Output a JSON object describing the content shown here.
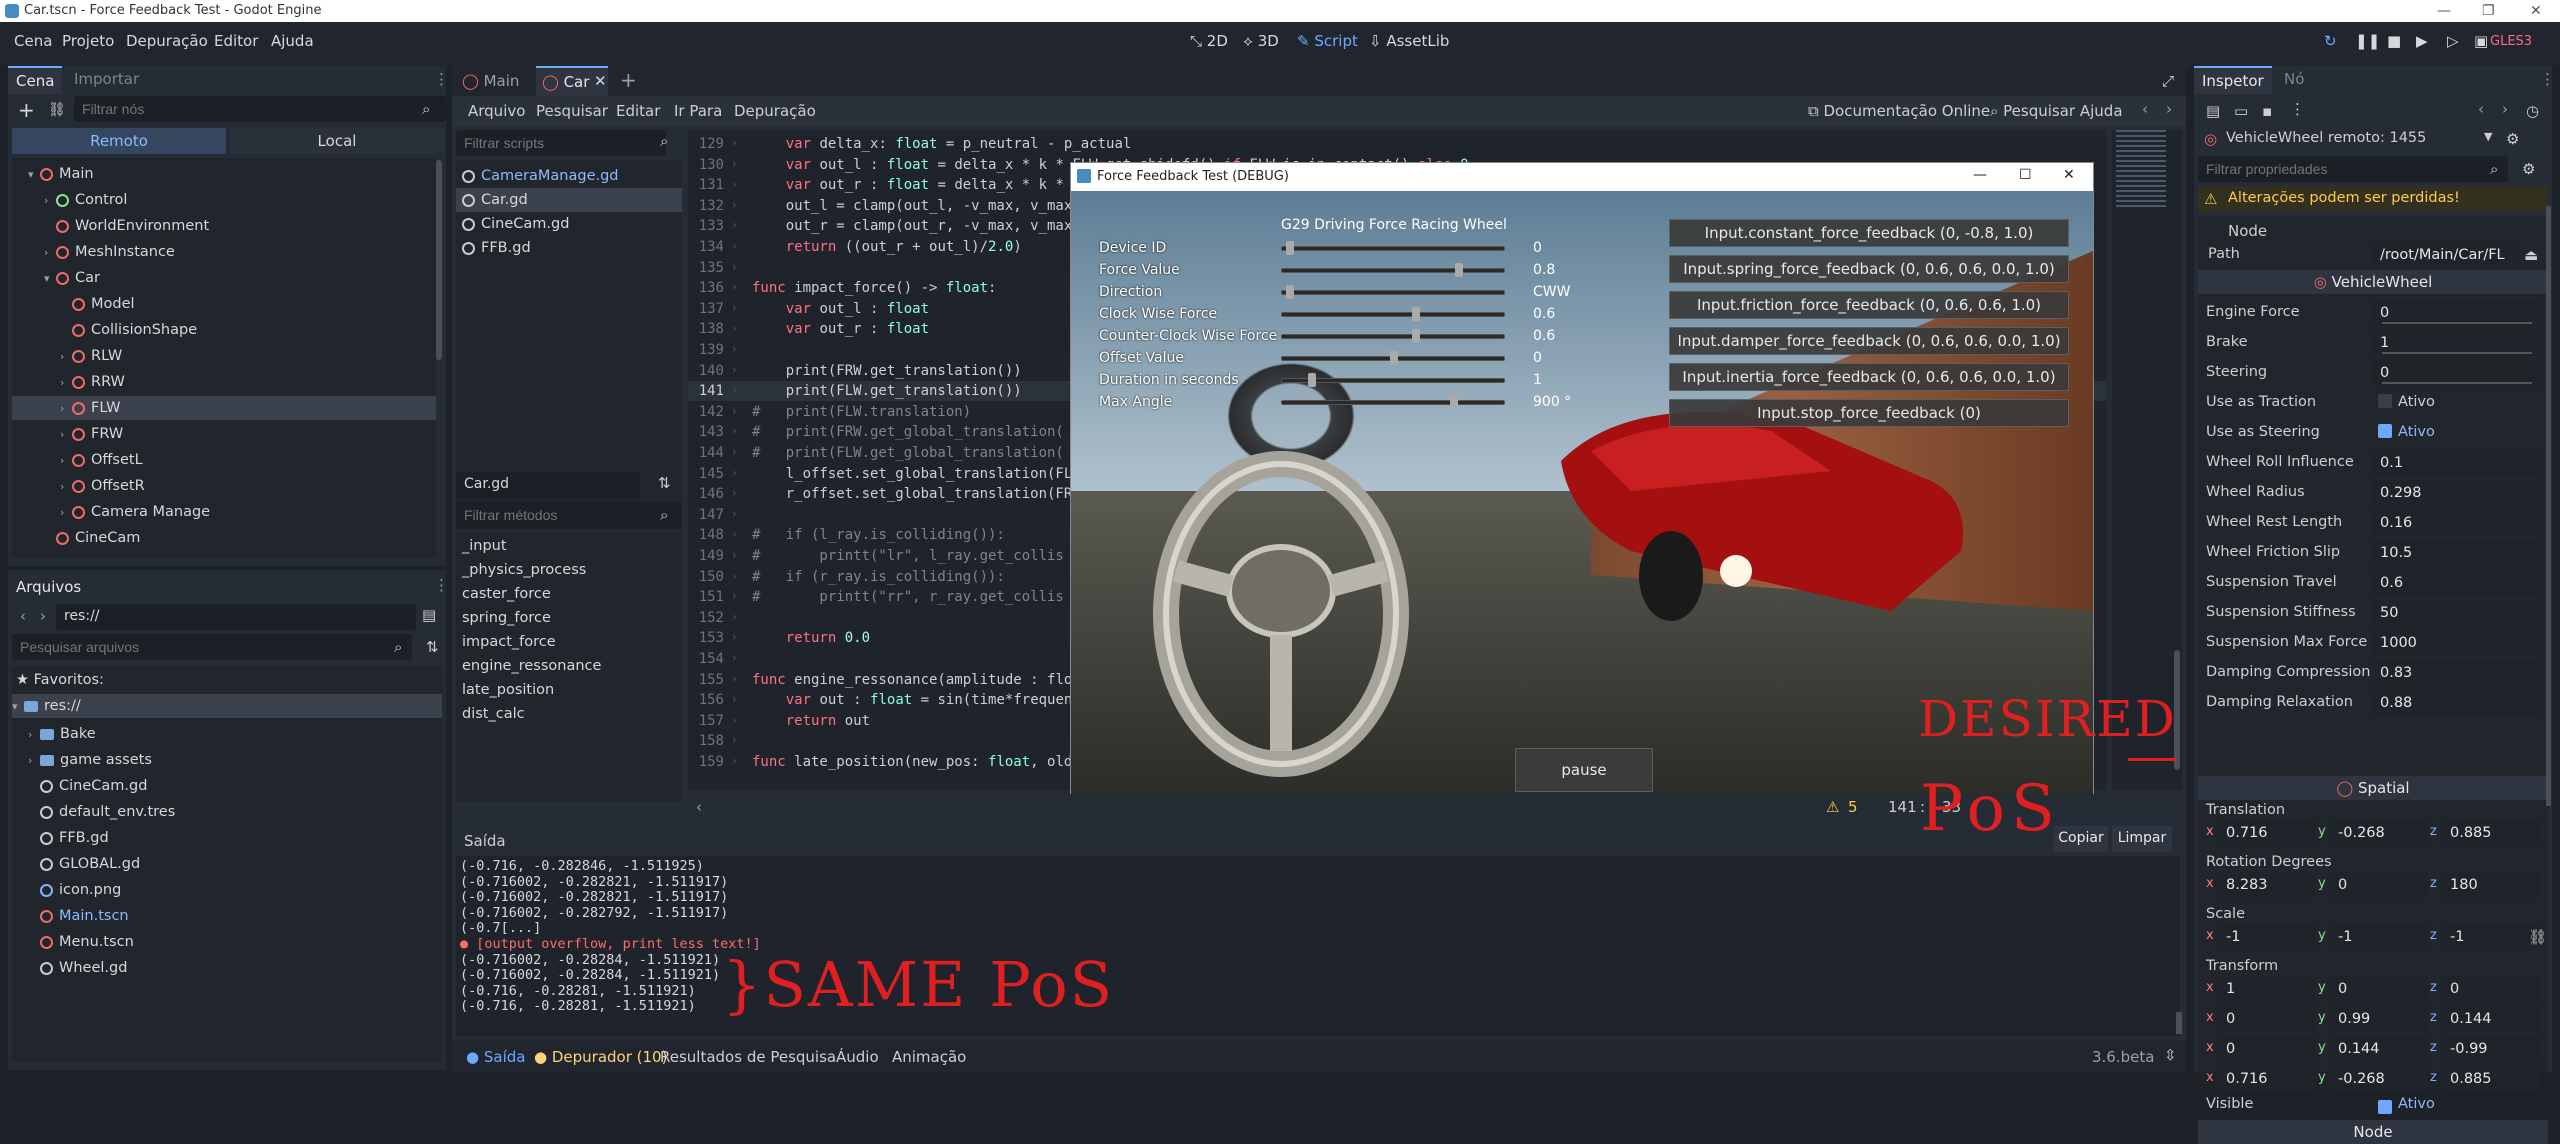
{
  "window": {
    "title": "Car.tscn - Force Feedback Test - Godot Engine"
  },
  "menu": {
    "items": [
      "Cena",
      "Projeto",
      "Depuração",
      "Editor",
      "Ajuda"
    ]
  },
  "main_tabs": [
    "2D",
    "3D",
    "Script",
    "AssetLib"
  ],
  "renderer": "GLES3",
  "scene_dock": {
    "tabs": [
      "Cena",
      "Importar"
    ],
    "filter_placeholder": "Filtrar nós",
    "modes": [
      "Remoto",
      "Local"
    ],
    "tree": [
      {
        "label": "Main",
        "indent": 1,
        "arrow": "▾",
        "icon": "red"
      },
      {
        "label": "Control",
        "indent": 2,
        "arrow": "›",
        "icon": "green"
      },
      {
        "label": "WorldEnvironment",
        "indent": 2,
        "arrow": "",
        "icon": "red"
      },
      {
        "label": "MeshInstance",
        "indent": 2,
        "arrow": "›",
        "icon": "red"
      },
      {
        "label": "Car",
        "indent": 2,
        "arrow": "▾",
        "icon": "red"
      },
      {
        "label": "Model",
        "indent": 3,
        "arrow": "",
        "icon": "red"
      },
      {
        "label": "CollisionShape",
        "indent": 3,
        "arrow": "",
        "icon": "red"
      },
      {
        "label": "RLW",
        "indent": 3,
        "arrow": "›",
        "icon": "red"
      },
      {
        "label": "RRW",
        "indent": 3,
        "arrow": "›",
        "icon": "red"
      },
      {
        "label": "FLW",
        "indent": 3,
        "arrow": "›",
        "icon": "red"
      },
      {
        "label": "FRW",
        "indent": 3,
        "arrow": "›",
        "icon": "red"
      },
      {
        "label": "OffsetL",
        "indent": 3,
        "arrow": "›",
        "icon": "red"
      },
      {
        "label": "OffsetR",
        "indent": 3,
        "arrow": "›",
        "icon": "red"
      },
      {
        "label": "Camera Manage",
        "indent": 3,
        "arrow": "›",
        "icon": "red"
      },
      {
        "label": "CineCam",
        "indent": 2,
        "arrow": "",
        "icon": "red"
      }
    ]
  },
  "files_dock": {
    "title": "Arquivos",
    "path": "res://",
    "search_placeholder": "Pesquisar arquivos",
    "favorites": "Favoritos:",
    "root": "res://",
    "items": [
      {
        "label": "Bake",
        "type": "folder"
      },
      {
        "label": "game assets",
        "type": "folder"
      },
      {
        "label": "CineCam.gd",
        "type": "script"
      },
      {
        "label": "default_env.tres",
        "type": "res"
      },
      {
        "label": "FFB.gd",
        "type": "script"
      },
      {
        "label": "GLOBAL.gd",
        "type": "script"
      },
      {
        "label": "icon.png",
        "type": "image"
      },
      {
        "label": "Main.tscn",
        "type": "scene"
      },
      {
        "label": "Menu.tscn",
        "type": "scene"
      },
      {
        "label": "Wheel.gd",
        "type": "script"
      }
    ]
  },
  "editor_tabs": [
    "Main",
    "Car"
  ],
  "script_menu": [
    "Arquivo",
    "Pesquisar",
    "Editar",
    "Ir Para",
    "Depuração"
  ],
  "script_links": [
    "Documentação Online",
    "Pesquisar Ajuda"
  ],
  "script_filter": "Filtrar scripts",
  "scripts": [
    "CameraManage.gd",
    "Car.gd",
    "CineCam.gd",
    "FFB.gd"
  ],
  "current_script": "Car.gd",
  "method_filter": "Filtrar métodos",
  "methods": [
    "_input",
    "_physics_process",
    "caster_force",
    "spring_force",
    "impact_force",
    "engine_ressonance",
    "late_position",
    "dist_calc"
  ],
  "code_lines": [
    {
      "n": "129",
      "html": "    var delta_x: float = p_neutral - p_actual"
    },
    {
      "n": "130",
      "html": "    var out_l : float = delta_x * k * FLW.get_shidefd() if FLW.is_in_contact() else 0"
    },
    {
      "n": "131",
      "html": "    var out_r : float = delta_x * k * "
    },
    {
      "n": "132",
      "html": "    out_l = clamp(out_l, -v_max, v_max"
    },
    {
      "n": "133",
      "html": "    out_r = clamp(out_r, -v_max, v_max"
    },
    {
      "n": "134",
      "html": "    return ((out_r + out_l)/2.0)"
    },
    {
      "n": "135",
      "html": ""
    },
    {
      "n": "136",
      "html": "func impact_force() -> float:"
    },
    {
      "n": "137",
      "html": "    var out_l : float"
    },
    {
      "n": "138",
      "html": "    var out_r : float"
    },
    {
      "n": "139",
      "html": ""
    },
    {
      "n": "140",
      "html": "    print(FRW.get_translation())"
    },
    {
      "n": "141",
      "html": "    print(FLW.get_translation())"
    },
    {
      "n": "142",
      "html": "#   print(FLW.translation)"
    },
    {
      "n": "143",
      "html": "#   print(FRW.get_global_translation("
    },
    {
      "n": "144",
      "html": "#   print(FLW.get_global_translation("
    },
    {
      "n": "145",
      "html": "    l_offset.set_global_translation(FL"
    },
    {
      "n": "146",
      "html": "    r_offset.set_global_translation(FR"
    },
    {
      "n": "147",
      "html": ""
    },
    {
      "n": "148",
      "html": "#   if (l_ray.is_colliding()):"
    },
    {
      "n": "149",
      "html": "#       printt(\"lr\", l_ray.get_collis"
    },
    {
      "n": "150",
      "html": "#   if (r_ray.is_colliding()):"
    },
    {
      "n": "151",
      "html": "#       printt(\"rr\", r_ray.get_collis"
    },
    {
      "n": "152",
      "html": ""
    },
    {
      "n": "153",
      "html": "    return 0.0"
    },
    {
      "n": "154",
      "html": ""
    },
    {
      "n": "155",
      "html": "func engine_ressonance(amplitude : flo"
    },
    {
      "n": "156",
      "html": "    var out : float = sin(time*frequen"
    },
    {
      "n": "157",
      "html": "    return out"
    },
    {
      "n": "158",
      "html": ""
    },
    {
      "n": "159",
      "html": "func late_position(new_pos: float, old"
    }
  ],
  "status": {
    "warnings": "5",
    "line": "141",
    "col": "33"
  },
  "output": {
    "title": "Saída",
    "copy": "Copiar",
    "clear": "Limpar",
    "lines": [
      "(-0.716, -0.282846, -1.511925)",
      "(-0.716002, -0.282821, -1.511917)",
      "(-0.716002, -0.282821, -1.511917)",
      "(-0.716002, -0.282792, -1.511917)",
      "(-0.7[...]"
    ],
    "error": "[output overflow, print less text!]",
    "lines2": [
      "(-0.716002, -0.28284, -1.511921)",
      "(-0.716002, -0.28284, -1.511921)",
      "(-0.716, -0.28281, -1.511921)",
      "(-0.716, -0.28281, -1.511921)"
    ]
  },
  "bottom_tabs": [
    "Saída",
    "Depurador (10)",
    "Resultados de Pesquisa",
    "Áudio",
    "Animação"
  ],
  "version": "3.6.beta",
  "game_window": {
    "title": "Force Feedback Test (DEBUG)",
    "wheel": "G29 Driving Force Racing Wheel",
    "params": [
      {
        "label": "Device ID",
        "value": "0",
        "pos": 0.02
      },
      {
        "label": "Force Value",
        "value": "0.8",
        "pos": 0.8
      },
      {
        "label": "Direction",
        "value": "CWW",
        "pos": 0.02
      },
      {
        "label": "Clock Wise Force",
        "value": "0.6",
        "pos": 0.6
      },
      {
        "label": "Counter-Clock Wise Force",
        "value": "0.6",
        "pos": 0.6
      },
      {
        "label": "Offset Value",
        "value": "0",
        "pos": 0.5
      },
      {
        "label": "Duration in seconds",
        "value": "1",
        "pos": 0.12
      },
      {
        "label": "Max Angle",
        "value": "900 °",
        "pos": 0.78
      }
    ],
    "buttons": [
      "Input.constant_force_feedback (0, -0.8, 1.0)",
      "Input.spring_force_feedback (0, 0.6, 0.6, 0.0, 1.0)",
      "Input.friction_force_feedback (0, 0.6, 0.6, 1.0)",
      "Input.damper_force_feedback (0, 0.6, 0.6, 0.0, 1.0)",
      "Input.inertia_force_feedback (0, 0.6, 0.6, 0.0, 1.0)",
      "Input.stop_force_feedback (0)"
    ],
    "pause": "pause"
  },
  "inspector": {
    "tabs": [
      "Inspetor",
      "Nó"
    ],
    "object": "VehicleWheel remoto: 1455",
    "filter_placeholder": "Filtrar propriedades",
    "warning": "Alterações podem ser perdidas!",
    "node_section": "Node",
    "path_label": "Path",
    "path_value": "/root/Main/Car/FL",
    "class": "VehicleWheel",
    "props": [
      {
        "label": "Engine Force",
        "value": "0"
      },
      {
        "label": "Brake",
        "value": "1"
      },
      {
        "label": "Steering",
        "value": "0"
      },
      {
        "label": "Use as Traction",
        "value": "Ativo"
      },
      {
        "label": "Use as Steering",
        "value": "Ativo"
      },
      {
        "label": "Wheel Roll Influence",
        "value": "0.1"
      },
      {
        "label": "Wheel Radius",
        "value": "0.298"
      },
      {
        "label": "Wheel Rest Length",
        "value": "0.16"
      },
      {
        "label": "Wheel Friction Slip",
        "value": "10.5"
      },
      {
        "label": "Suspension Travel",
        "value": "0.6"
      },
      {
        "label": "Suspension Stiffness",
        "value": "50"
      },
      {
        "label": "Suspension Max Force",
        "value": "1000"
      },
      {
        "label": "Damping Compression",
        "value": "0.83"
      },
      {
        "label": "Damping Relaxation",
        "value": "0.88"
      }
    ],
    "spatial": "Spatial",
    "translation_label": "Translation",
    "translation": [
      "0.716",
      "-0.268",
      "0.885"
    ],
    "rotation_label": "Rotation Degrees",
    "rotation": [
      "8.283",
      "0",
      "180"
    ],
    "scale_label": "Scale",
    "scale": [
      "-1",
      "-1",
      "-1"
    ],
    "transform_label": "Transform",
    "transform": [
      [
        "1",
        "0",
        "0"
      ],
      [
        "0",
        "0.99",
        "0.144"
      ],
      [
        "0",
        "0.144",
        "-0.99"
      ],
      [
        "0.716",
        "-0.268",
        "0.885"
      ]
    ],
    "visible_label": "Visible",
    "visible_value": "Ativo",
    "node2": "Node"
  },
  "annotations": {
    "same": "}SAME PoS",
    "desired": "DESIRED",
    "pos": "PoS"
  }
}
